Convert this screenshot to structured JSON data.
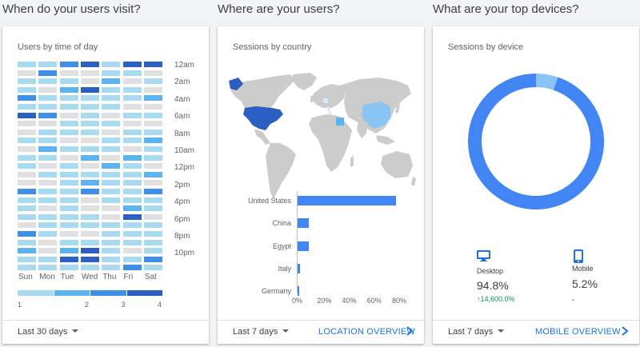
{
  "sections": {
    "visit_title": "When do your users visit?",
    "where_title": "Where are your users?",
    "devices_title": "What are your top devices?"
  },
  "time_card": {
    "title": "Users by time of day",
    "days": [
      "Sun",
      "Mon",
      "Tue",
      "Wed",
      "Thu",
      "Fri",
      "Sat"
    ],
    "hour_labels": [
      "12am",
      "2am",
      "4am",
      "6am",
      "8am",
      "10am",
      "12pm",
      "2pm",
      "4pm",
      "6pm",
      "8pm",
      "10pm"
    ],
    "legend": [
      "1",
      "2",
      "3",
      "4"
    ],
    "range": "Last 30 days",
    "colors": [
      "#e0e0e0",
      "#a8dbf0",
      "#5bb4f0",
      "#3f8fe8",
      "#2c5fc2"
    ],
    "levels": [
      [
        1,
        1,
        3,
        4,
        1,
        4,
        4
      ],
      [
        0,
        3,
        0,
        0,
        1,
        1,
        0
      ],
      [
        1,
        1,
        1,
        0,
        2,
        0,
        1
      ],
      [
        1,
        0,
        2,
        4,
        1,
        1,
        0
      ],
      [
        3,
        1,
        1,
        1,
        1,
        1,
        2
      ],
      [
        1,
        1,
        1,
        1,
        1,
        0,
        0
      ],
      [
        4,
        3,
        0,
        1,
        0,
        1,
        1
      ],
      [
        0,
        0,
        1,
        1,
        1,
        0,
        0
      ],
      [
        0,
        1,
        1,
        1,
        0,
        1,
        1
      ],
      [
        1,
        1,
        0,
        0,
        1,
        1,
        2
      ],
      [
        0,
        2,
        1,
        1,
        1,
        0,
        1
      ],
      [
        1,
        1,
        0,
        2,
        0,
        2,
        1
      ],
      [
        1,
        0,
        1,
        0,
        2,
        1,
        0
      ],
      [
        0,
        1,
        1,
        1,
        1,
        1,
        2
      ],
      [
        0,
        0,
        1,
        2,
        1,
        1,
        0
      ],
      [
        3,
        1,
        1,
        3,
        1,
        1,
        3
      ],
      [
        1,
        1,
        1,
        0,
        1,
        1,
        1
      ],
      [
        1,
        0,
        1,
        0,
        0,
        2,
        1
      ],
      [
        1,
        1,
        1,
        1,
        0,
        4,
        0
      ],
      [
        0,
        1,
        1,
        1,
        1,
        1,
        1
      ],
      [
        3,
        1,
        0,
        0,
        1,
        1,
        1
      ],
      [
        1,
        0,
        1,
        1,
        1,
        1,
        1
      ],
      [
        2,
        0,
        2,
        4,
        1,
        0,
        1
      ],
      [
        1,
        1,
        4,
        4,
        1,
        1,
        3
      ],
      [
        1,
        1,
        1,
        1,
        1,
        3,
        1
      ]
    ]
  },
  "country_card": {
    "title": "Sessions by country",
    "range": "Last 7 days",
    "overview_link": "LOCATION OVERVIEW",
    "chart_data": {
      "type": "bar",
      "categories": [
        "United States",
        "China",
        "Egypt",
        "Italy",
        "Germany"
      ],
      "values": [
        79,
        9,
        9,
        2,
        1
      ],
      "xlim": [
        0,
        80
      ],
      "ticks": [
        "0%",
        "20%",
        "40%",
        "60%",
        "80%"
      ]
    }
  },
  "device_card": {
    "title": "Sessions by device",
    "range": "Last 7 days",
    "overview_link": "MOBILE OVERVIEW",
    "chart_data": {
      "type": "pie",
      "categories": [
        "Desktop",
        "Mobile"
      ],
      "values": [
        94.8,
        5.2
      ],
      "colors": [
        "#4285f4",
        "#8ac4f5"
      ]
    },
    "desktop": {
      "label": "Desktop",
      "value": "94.8%",
      "change": "14,600.0%",
      "change_color": "#0d904f"
    },
    "mobile": {
      "label": "Mobile",
      "value": "5.2%",
      "change": "-"
    }
  }
}
